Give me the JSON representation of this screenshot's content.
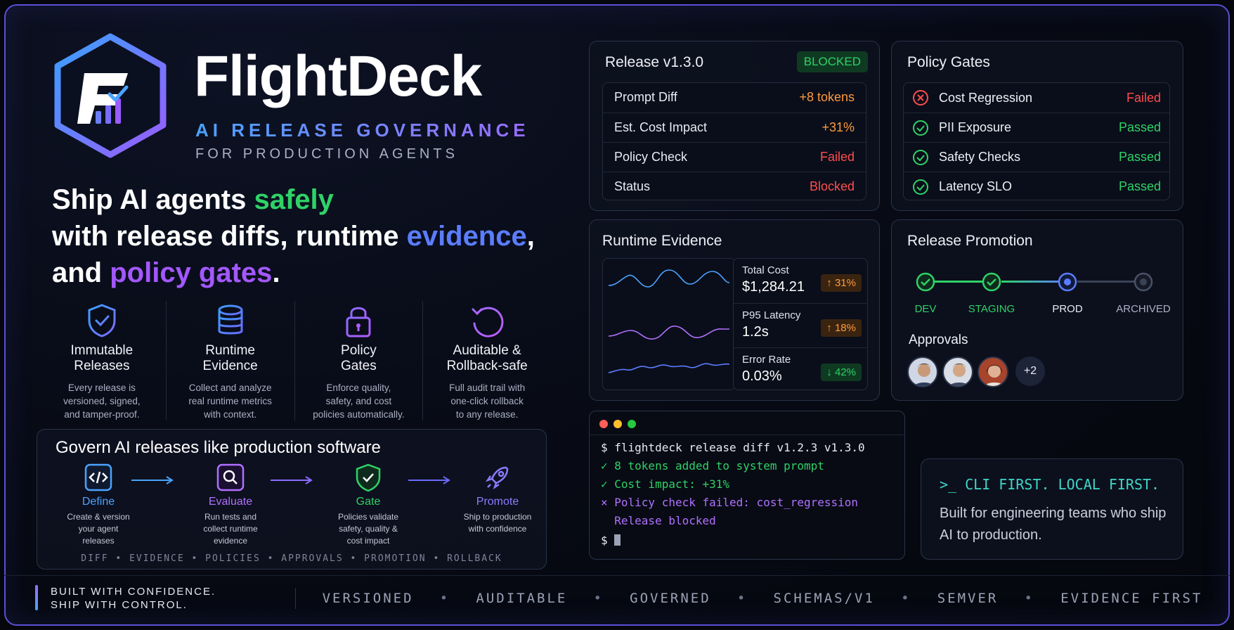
{
  "brand": {
    "name": "FlightDeck",
    "tagline": "AI RELEASE GOVERNANCE",
    "subtagline": "FOR PRODUCTION AGENTS",
    "logo_icon": "flightdeck-logo-icon"
  },
  "headline": {
    "part1": "Ship AI agents ",
    "safely": "safely",
    "part2": "with release diffs,  runtime ",
    "evidence": "evidence",
    "comma": ",",
    "part3": "and ",
    "policy_gates": "policy gates",
    "period": "."
  },
  "features": [
    {
      "icon": "shield-check-icon",
      "title_line1": "Immutable",
      "title_line2": "Releases",
      "desc": [
        "Every release is",
        "versioned, signed,",
        "and tamper-proof."
      ]
    },
    {
      "icon": "database-icon",
      "title_line1": "Runtime",
      "title_line2": "Evidence",
      "desc": [
        "Collect and analyze",
        "real runtime metrics",
        "with context."
      ]
    },
    {
      "icon": "lock-icon",
      "title_line1": "Policy",
      "title_line2": "Gates",
      "desc": [
        "Enforce quality,",
        "safety, and cost",
        "policies automatically."
      ]
    },
    {
      "icon": "rollback-icon",
      "title_line1": "Auditable &",
      "title_line2": "Rollback-safe",
      "desc": [
        "Full audit trail with",
        "one-click rollback",
        "to any release."
      ]
    }
  ],
  "govern": {
    "title": "Govern AI releases like production software",
    "steps": [
      {
        "icon": "code-icon",
        "name": "Define",
        "color": "#4aa3ff",
        "desc": [
          "Create & version",
          "your agent",
          "releases"
        ]
      },
      {
        "icon": "search-icon",
        "name": "Evaluate",
        "color": "#b070ff",
        "desc": [
          "Run tests and",
          "collect runtime",
          "evidence"
        ]
      },
      {
        "icon": "shield-check-icon",
        "name": "Gate",
        "color": "#2fd267",
        "desc": [
          "Policies validate",
          "safety, quality &",
          "cost impact"
        ]
      },
      {
        "icon": "rocket-icon",
        "name": "Promote",
        "color": "#8a7cff",
        "desc": [
          "Ship to production",
          "with confidence"
        ]
      }
    ],
    "tags": "DIFF  •  EVIDENCE  •  POLICIES  •  APPROVALS  •  PROMOTION  •  ROLLBACK"
  },
  "release": {
    "title": "Release v1.3.0",
    "badge": "BLOCKED",
    "rows": [
      {
        "key": "Prompt Diff",
        "value": "+8 tokens",
        "color": "#ff9a3c"
      },
      {
        "key": "Est. Cost Impact",
        "value": "+31%",
        "color": "#ff9a3c"
      },
      {
        "key": "Policy Check",
        "value": "Failed",
        "color": "#ff4d4d"
      },
      {
        "key": "Status",
        "value": "Blocked",
        "color": "#ff4d4d"
      }
    ]
  },
  "gates": {
    "title": "Policy Gates",
    "rows": [
      {
        "icon": "x-circle-icon",
        "name": "Cost Regression",
        "status": "Failed",
        "color": "#ff4d4d"
      },
      {
        "icon": "check-circle-icon",
        "name": "PII Exposure",
        "status": "Passed",
        "color": "#2fd267"
      },
      {
        "icon": "check-circle-icon",
        "name": "Safety Checks",
        "status": "Passed",
        "color": "#2fd267"
      },
      {
        "icon": "check-circle-icon",
        "name": "Latency SLO",
        "status": "Passed",
        "color": "#2fd267"
      }
    ]
  },
  "evidence": {
    "title": "Runtime Evidence",
    "metrics": [
      {
        "label": "Total Cost",
        "value": "$1,284.21",
        "delta": "↑ 31%",
        "direction": "up",
        "spark_color": "#4aa3ff"
      },
      {
        "label": "P95 Latency",
        "value": "1.2s",
        "delta": "↑ 18%",
        "direction": "up",
        "spark_color": "#b070ff"
      },
      {
        "label": "Error Rate",
        "value": "0.03%",
        "delta": "↓ 42%",
        "direction": "down",
        "spark_color": "#5b7dff"
      }
    ]
  },
  "promotion": {
    "title": "Release Promotion",
    "stages": [
      {
        "label": "DEV",
        "state": "done",
        "color": "#2fd267"
      },
      {
        "label": "STAGING",
        "state": "done",
        "color": "#2fd267"
      },
      {
        "label": "PROD",
        "state": "current",
        "color": "#e8ebf3"
      },
      {
        "label": "ARCHIVED",
        "state": "pending",
        "color": "#aab0c4"
      }
    ],
    "approvals_label": "Approvals",
    "approvers_more": "+2"
  },
  "terminal": {
    "lines": [
      {
        "text": "$ flightdeck release diff v1.2.3 v1.3.0",
        "color": "#e6e9f2"
      },
      {
        "text": "✓ 8 tokens added to system prompt",
        "color": "#2fd267"
      },
      {
        "text": "✓ Cost impact: +31%",
        "color": "#2fd267"
      },
      {
        "text": "× Policy check failed: cost_regression",
        "color": "#b070ff"
      },
      {
        "text": "  Release blocked",
        "color": "#b070ff"
      },
      {
        "text": "$ ",
        "color": "#e6e9f2"
      }
    ]
  },
  "cli": {
    "heading": ">_ CLI FIRST. LOCAL FIRST.",
    "text": "Built for engineering teams who ship AI to production."
  },
  "footer": {
    "left_line1": "BUILT WITH CONFIDENCE.",
    "left_line2": "SHIP WITH CONTROL.",
    "tags": [
      "VERSIONED",
      "AUDITABLE",
      "GOVERNED",
      "SCHEMAS/V1",
      "SEMVER",
      "EVIDENCE FIRST"
    ]
  }
}
